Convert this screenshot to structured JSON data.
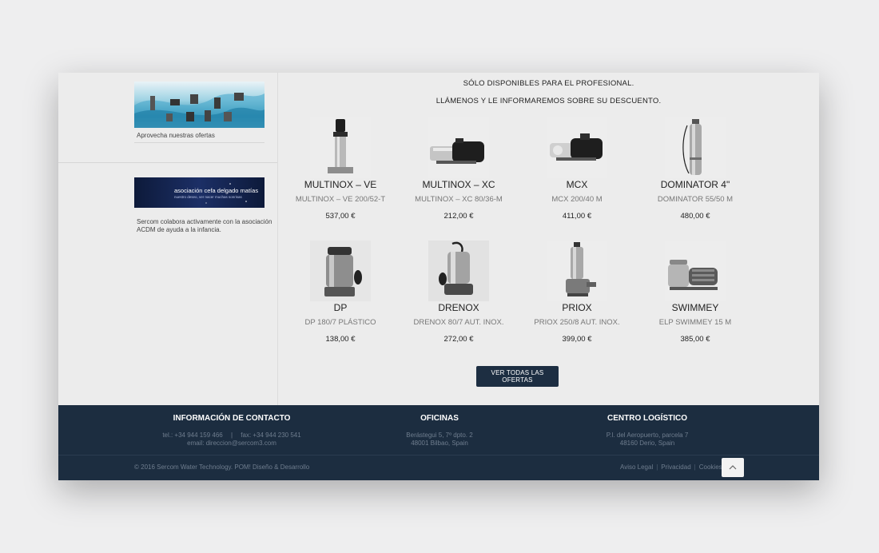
{
  "sidebar": {
    "offer_caption": "Aprovecha nuestras ofertas",
    "assoc_banner_title": "asociación cefa delgado matías",
    "assoc_banner_subtitle": "nuestro deseo, ver nacer muchas sonrisas",
    "assoc_caption_line1": "Sercom colabora activamente con la asociación",
    "assoc_caption_line2": "ACDM de ayuda a la infancia."
  },
  "promo": {
    "line1": "SÓLO DISPONIBLES PARA EL PROFESIONAL.",
    "line2": "LLÁMENOS Y LE INFORMAREMOS SOBRE SU DESCUENTO."
  },
  "products": [
    {
      "name": "MULTINOX – VE",
      "model": "MULTINOX – VE 200/52-T",
      "price": "537,00 €",
      "icon": "vertical-pump-icon"
    },
    {
      "name": "MULTINOX – XC",
      "model": "MULTINOX – XC 80/36-M",
      "price": "212,00 €",
      "icon": "horizontal-pump-icon"
    },
    {
      "name": "MCX",
      "model": "MCX 200/40 M",
      "price": "411,00 €",
      "icon": "horizontal-pump-icon"
    },
    {
      "name": "DOMINATOR 4\"",
      "model": "DOMINATOR 55/50 M",
      "price": "480,00 €",
      "icon": "borehole-pump-icon"
    },
    {
      "name": "DP",
      "model": "DP 180/7 PLÁSTICO",
      "price": "138,00 €",
      "icon": "submersible-pump-icon"
    },
    {
      "name": "DRENOX",
      "model": "DRENOX 80/7 AUT. INOX.",
      "price": "272,00 €",
      "icon": "submersible-pump-icon"
    },
    {
      "name": "PRIOX",
      "model": "PRIOX 250/8 AUT. INOX.",
      "price": "399,00 €",
      "icon": "sewage-pump-icon"
    },
    {
      "name": "SWIMMEY",
      "model": "ELP SWIMMEY 15 M",
      "price": "385,00 €",
      "icon": "pool-pump-icon"
    }
  ],
  "cta": {
    "label": "VER TODAS LAS OFERTAS"
  },
  "footer": {
    "contact": {
      "heading": "INFORMACIÓN DE CONTACTO",
      "phone": "tel.: +34 944 159 466",
      "fax": "fax: +34 944 230 541",
      "email": "email: direccion@sercom3.com"
    },
    "offices": {
      "heading": "OFICINAS",
      "line1": "Berástegui 5, 7º dpto. 2",
      "line2": "48001 Bilbao, Spain"
    },
    "logistics": {
      "heading": "CENTRO LOGÍSTICO",
      "line1": "P.I. del Aeropuerto, parcela 7",
      "line2": "48160 Derio, Spain"
    },
    "copyright": "© 2016 Sercom Water Technology.",
    "credit": "POM! Diseño & Desarrollo",
    "links": [
      "Aviso Legal",
      "Privacidad",
      "Cookies"
    ],
    "to_top_icon": "chevron-up-icon"
  },
  "colors": {
    "footer_bg": "#1c2d40",
    "button_bg": "#1d2e42",
    "page_bg": "#ececec"
  }
}
